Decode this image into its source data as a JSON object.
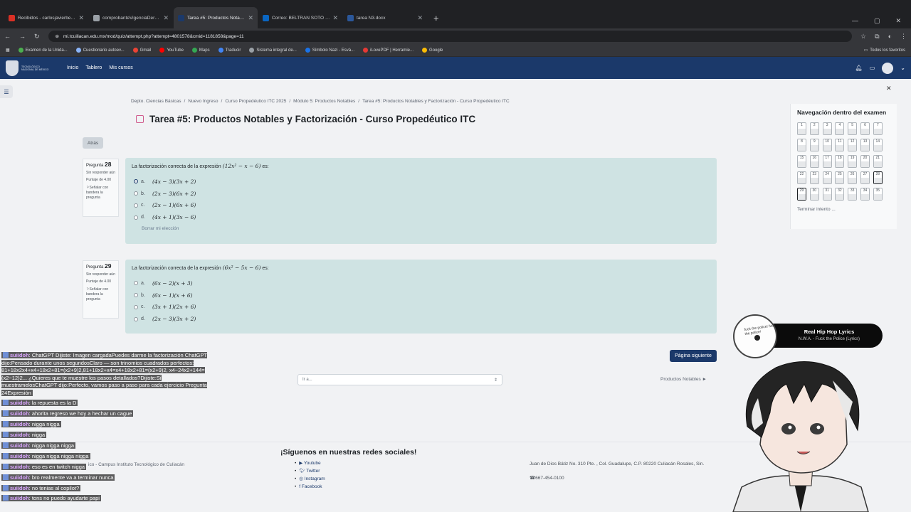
{
  "browser": {
    "tabs": [
      {
        "title": "Recibidos - carlosjavierbeltran",
        "color": "#d93025"
      },
      {
        "title": "comprobanteVigenciaDerecho",
        "color": "#9aa0a6"
      },
      {
        "title": "Tarea #5: Productos Notables y",
        "color": "#1b396a"
      },
      {
        "title": "Correo: BELTRAN SOTO CARLOS",
        "color": "#0a66c2"
      },
      {
        "title": "tarea N3.docx",
        "color": "#2b579a"
      }
    ],
    "url": "mi.tcuiliacan.edu.mx/mod/quiz/attempt.php?attempt=4801578&cmid=1181858&page=11",
    "bookmarks": [
      "Examen de la Unida...",
      "Cuestionario autoev...",
      "Gmail",
      "YouTube",
      "Maps",
      "Traducir",
      "Sistema integral de...",
      "Símbolo Nazi - Esvá...",
      "iLovePDF | Herramie...",
      "Google"
    ],
    "bookmarks_right": "Todos los favoritos"
  },
  "nav": {
    "logo_text": "TECNOLÓGICO NACIONAL DE MÉXICO",
    "links": [
      "Inicio",
      "Tablero",
      "Mis cursos"
    ]
  },
  "breadcrumbs": [
    "Depto. Ciencias Básicas",
    "Nuevo Ingreso",
    "Curso Propedéutico ITC 2025",
    "Módulo 5: Productos Notables",
    "Tarea #5: Productos Notables y Factorización - Curso Propedéutico ITC"
  ],
  "page_title": "Tarea #5: Productos Notables y Factorización - Curso Propedéutico ITC",
  "back_label": "Atrás",
  "questions": [
    {
      "label": "Pregunta",
      "number": "28",
      "status": "Sin responder aún",
      "score": "Puntaje de 4.00",
      "flag": "Señalar con bandera la pregunta",
      "text_before": "La factorización correcta de la expresión",
      "expr": "(12x² − x − 6)",
      "text_after": "es:",
      "options": [
        {
          "letter": "a.",
          "expr": "(4x − 3)(3x + 2)",
          "selected": true
        },
        {
          "letter": "b.",
          "expr": "(2x − 3)(6x + 2)",
          "selected": false
        },
        {
          "letter": "c.",
          "expr": "(2x − 1)(6x + 6)",
          "selected": false
        },
        {
          "letter": "d.",
          "expr": "(4x + 1)(3x − 6)",
          "selected": false
        }
      ],
      "clear": "Borrar mi elección"
    },
    {
      "label": "Pregunta",
      "number": "29",
      "status": "Sin responder aún",
      "score": "Puntaje de 4.00",
      "flag": "Señalar con bandera la pregunta",
      "text_before": "La factorización correcta de la expresión",
      "expr": "(6x² − 5x − 6)",
      "text_after": "es:",
      "options": [
        {
          "letter": "a.",
          "expr": "(6x − 2)(x + 3)",
          "selected": false
        },
        {
          "letter": "b.",
          "expr": "(6x − 1)(x + 6)",
          "selected": false
        },
        {
          "letter": "c.",
          "expr": "(3x + 1)(2x + 6)",
          "selected": false
        },
        {
          "letter": "d.",
          "expr": "(2x − 3)(3x + 2)",
          "selected": false
        }
      ],
      "clear": ""
    }
  ],
  "next_page": "Página siguiente",
  "jump_placeholder": "Ir a...",
  "next_activity": "Productos Notables ►",
  "quiz_nav": {
    "title": "Navegación dentro del examen",
    "numbers": [
      "1",
      "2",
      "3",
      "4",
      "5",
      "6",
      "7",
      "8",
      "9",
      "10",
      "11",
      "12",
      "13",
      "14",
      "15",
      "16",
      "17",
      "18",
      "19",
      "20",
      "21",
      "22",
      "23",
      "24",
      "25",
      "26",
      "27",
      "28",
      "29",
      "30",
      "31",
      "32",
      "33",
      "34",
      "35"
    ],
    "finish": "Terminar intento ..."
  },
  "footer": {
    "left": "ico - Campus Instituto Tecnológico de Culiacán",
    "social_title": "¡Síguenos en nuestras redes sociales!",
    "social": [
      "Youtube",
      "Twitter",
      "Instagram",
      "Facebook"
    ],
    "address": "Juan de Dios Bátiz No. 310 Pte. , Col. Guadalupe, C.P. 80220 Culiacán Rosales, Sin.",
    "phone": "667-454-0100"
  },
  "chat": [
    {
      "user": "suiidoh",
      "text": ": ChatGPT Dijiste: Imagen cargadaPuedes darme la factorización ChatGPT dijo:Pensado durante unos segundosClaro — son trinomios cuadrados perfectos: 81+18x2x4+x4+18x2+81=(x2+9)2,81+18x2+x4=x4+18x2+81=(x2+9)2, x4−24x2+144=(x2−12)2... ¿Quieres que te muestre los pasos detallados?Dijiste:Si muestramelosChatGPT dijo:Perfecto, vamos paso a paso para cada ejercicio Pregunta 24Expresión"
    },
    {
      "user": "suiidoh",
      "text": ": la repuesta es la D"
    },
    {
      "user": "suiidoh",
      "text": ": ahorita regreso we hoy a hechar un cague"
    },
    {
      "user": "suiidoh",
      "text": ": nigga nigga"
    },
    {
      "user": "suiidoh",
      "text": ": nigga"
    },
    {
      "user": "suiidoh",
      "text": ": nigga nigga nigga"
    },
    {
      "user": "suiidoh",
      "text": ": nigga nigga nigga nigga"
    },
    {
      "user": "suiidoh",
      "text": ": eso es en twitch nigga"
    },
    {
      "user": "suiidoh",
      "text": ": bro realmente va a terminar nunca"
    },
    {
      "user": "suiidoh",
      "text": ": no tenias al copilot?"
    },
    {
      "user": "suiidoh",
      "text": ": tons no puedo ayudarte papi"
    }
  ],
  "music": {
    "title": "Real Hip Hop Lyrics",
    "subtitle": "N.W.A. - Fuck the Police (Lyrics)",
    "disc_text": "fuck the police! fuck the police!"
  }
}
